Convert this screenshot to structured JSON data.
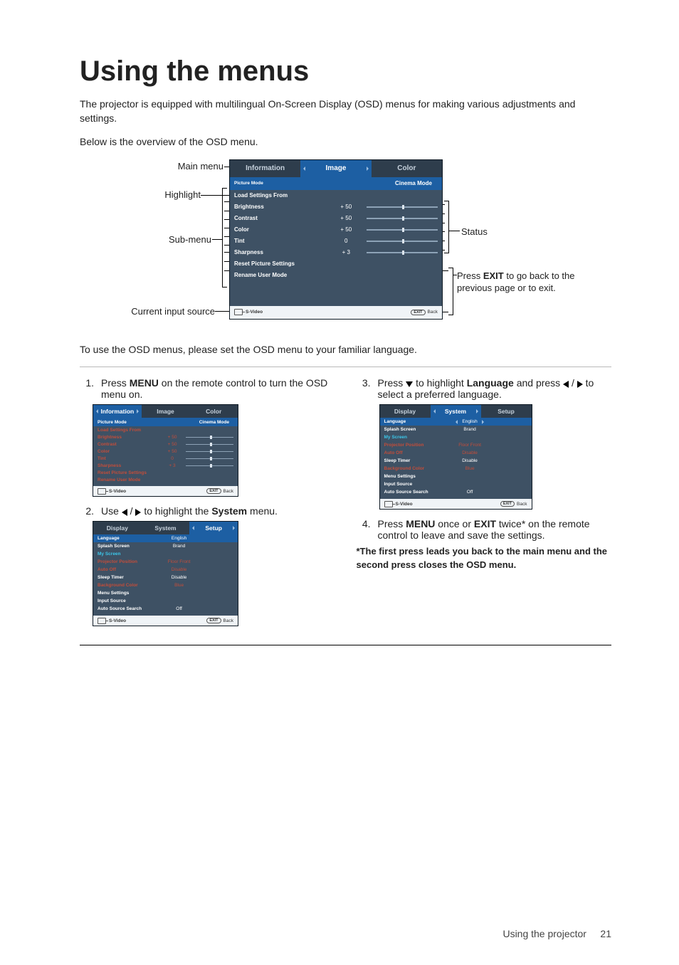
{
  "title": "Using the menus",
  "intro_1": "The projector is equipped with multilingual On-Screen Display (OSD) menus for making various adjustments and settings.",
  "intro_2": "Below is the overview of the OSD menu.",
  "outro": "To use the OSD menus, please set the OSD menu to your familiar language.",
  "annotations": {
    "main_menu": "Main menu",
    "highlight": "Highlight",
    "sub_menu": "Sub-menu",
    "input_source": "Current input source",
    "status": "Status",
    "exit_line1": "Press ",
    "exit_bold": "EXIT",
    "exit_line2": " to go back to the previous page or to exit."
  },
  "osd_image": {
    "tabs": [
      "Information",
      "Image",
      "Color"
    ],
    "active_tab_index": 1,
    "right_header_value": "Cinema Mode",
    "rows": [
      {
        "label": "Picture Mode",
        "value": "",
        "slider": false,
        "class": "hl"
      },
      {
        "label": "Load Settings From",
        "value": "",
        "slider": false,
        "class": "sub"
      },
      {
        "label": "Brightness",
        "value": "+ 50",
        "slider": true,
        "class": "sub"
      },
      {
        "label": "Contrast",
        "value": "+ 50",
        "slider": true,
        "class": "sub"
      },
      {
        "label": "Color",
        "value": "+ 50",
        "slider": true,
        "class": "sub"
      },
      {
        "label": "Tint",
        "value": "0",
        "slider": true,
        "class": "sub"
      },
      {
        "label": "Sharpness",
        "value": "+ 3",
        "slider": true,
        "class": "sub"
      },
      {
        "label": "Reset Picture Settings",
        "value": "",
        "slider": false,
        "class": "sub"
      },
      {
        "label": "Rename User Mode",
        "value": "",
        "slider": false,
        "class": "sub"
      }
    ],
    "source": "S-Video",
    "exit": "EXIT",
    "back": "Back"
  },
  "osd_system_highlighted": {
    "tabs": [
      "Display",
      "System",
      "Setup"
    ],
    "active_tab_index": 2,
    "rows": [
      {
        "label": "Language",
        "valueR": "English",
        "class": "hl"
      },
      {
        "label": "Splash Screen",
        "valueR": "Brand",
        "class": ""
      },
      {
        "label": "My Screen",
        "valueR": "",
        "class": "cyan"
      },
      {
        "label": "Projector Position",
        "valueR": "Floor Front",
        "class": "red"
      },
      {
        "label": "Auto Off",
        "valueR": "Disable",
        "class": "red"
      },
      {
        "label": "Sleep Timer",
        "valueR": "Disable",
        "class": ""
      },
      {
        "label": "Background Color",
        "valueR": "Blue",
        "class": "red"
      },
      {
        "label": "Menu Settings",
        "valueR": "",
        "class": ""
      },
      {
        "label": "Input Source",
        "valueR": "",
        "class": ""
      },
      {
        "label": "Auto Source Search",
        "valueR": "Off",
        "class": ""
      }
    ],
    "source": "S-Video",
    "exit": "EXIT",
    "back": "Back"
  },
  "osd_system_setup": {
    "tabs": [
      "Display",
      "System",
      "Setup"
    ],
    "active_tab_index": 1,
    "rows": [
      {
        "label": "Language",
        "valueR": "English",
        "class": "hl"
      },
      {
        "label": "Splash Screen",
        "valueR": "Brand",
        "class": ""
      },
      {
        "label": "My Screen",
        "valueR": "",
        "class": "cyan"
      },
      {
        "label": "Projector Position",
        "valueR": "Floor Front",
        "class": "red"
      },
      {
        "label": "Auto Off",
        "valueR": "Disable",
        "class": "red"
      },
      {
        "label": "Sleep Timer",
        "valueR": "Disable",
        "class": ""
      },
      {
        "label": "Background Color",
        "valueR": "Blue",
        "class": "red"
      },
      {
        "label": "Menu Settings",
        "valueR": "",
        "class": ""
      },
      {
        "label": "Input Source",
        "valueR": "",
        "class": ""
      },
      {
        "label": "Auto Source Search",
        "valueR": "Off",
        "class": ""
      }
    ],
    "source": "S-Video",
    "exit": "EXIT",
    "back": "Back"
  },
  "steps": {
    "s1_a": "Press ",
    "s1_b": "MENU",
    "s1_c": " on the remote control to turn the OSD menu on.",
    "s2_a": "Use ",
    "s2_b": " to highlight the ",
    "s2_c": "System",
    "s2_d": " menu.",
    "s3_a": "Press ",
    "s3_b": " to highlight ",
    "s3_c": "Language",
    "s3_d": " and press ",
    "s3_e": " to select a preferred language.",
    "s4_a": "Press ",
    "s4_b": "MENU",
    "s4_c": " once or ",
    "s4_d": "EXIT",
    "s4_e": " twice* on the remote control to leave and save the settings.",
    "note": "*The first press leads you back to the main menu and the second press closes the OSD menu."
  },
  "footer": {
    "label": "Using the projector",
    "num": "21"
  }
}
